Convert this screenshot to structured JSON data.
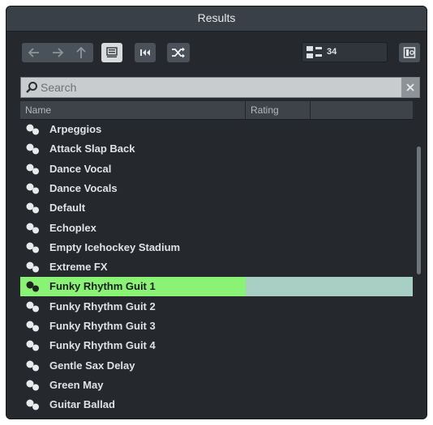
{
  "window": {
    "title": "Results"
  },
  "toolbar": {
    "back_icon": "arrow-left-icon",
    "forward_icon": "arrow-right-icon",
    "up_icon": "arrow-up-icon",
    "view_icon": "list-view-icon",
    "previous_icon": "rewind-icon",
    "shuffle_icon": "shuffle-icon",
    "result_count": "34",
    "options_icon": "panel-options-icon"
  },
  "search": {
    "placeholder": "Search"
  },
  "table": {
    "columns": [
      "Name",
      "Rating"
    ],
    "rows": [
      {
        "name": "Arpeggios"
      },
      {
        "name": "Attack Slap Back"
      },
      {
        "name": "Dance Vocal"
      },
      {
        "name": "Dance Vocals"
      },
      {
        "name": "Default"
      },
      {
        "name": "Echoplex"
      },
      {
        "name": "Empty Icehockey Stadium"
      },
      {
        "name": "Extreme FX"
      },
      {
        "name": "Funky Rhythm Guit 1",
        "selected": true
      },
      {
        "name": "Funky Rhythm Guit 2"
      },
      {
        "name": "Funky Rhythm Guit 3"
      },
      {
        "name": "Funky Rhythm Guit 4"
      },
      {
        "name": "Gentle Sax Delay"
      },
      {
        "name": "Green May"
      },
      {
        "name": "Guitar Ballad"
      }
    ]
  },
  "colors": {
    "selected_row": "#8af275",
    "selected_row_rest": "#a8cfc4",
    "background": "#25292e"
  }
}
